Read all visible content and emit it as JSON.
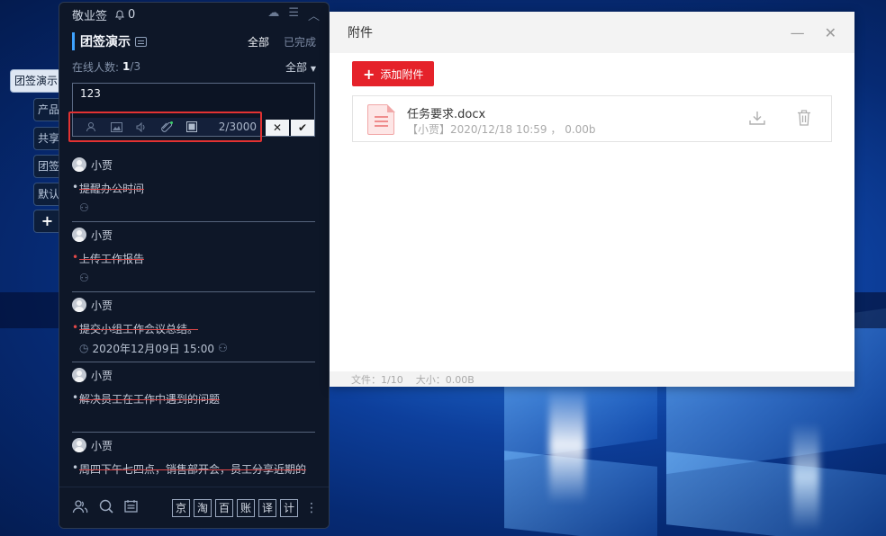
{
  "app": {
    "title": "敬业签",
    "notification_count": "0",
    "project_title": "团签演示",
    "filter_all": "全部",
    "filter_done": "已完成",
    "online_label": "在线人数:",
    "online_current": "1",
    "online_total": "/3",
    "member_filter": "全部",
    "editor_text": "123",
    "counter": "2/3000",
    "cancel_label": "✕",
    "confirm_label": "✔"
  },
  "side_tabs": [
    "团签演示",
    "产品",
    "共享",
    "团签",
    "默认",
    "+"
  ],
  "tasks": [
    {
      "user": "小贾",
      "text": "提醒办公时间",
      "red_bullet": false,
      "time": ""
    },
    {
      "user": "小贾",
      "text": "上传工作报告",
      "red_bullet": true,
      "time": ""
    },
    {
      "user": "小贾",
      "text": "提交小组工作会议总结。",
      "red_bullet": true,
      "time": "2020年12月09日 15:00"
    },
    {
      "user": "小贾",
      "text": "解决员工在工作中遇到的问题",
      "red_bullet": false,
      "time": ""
    },
    {
      "user": "小贾",
      "text": "周四下午七四点，销售部开会，员工分享近期的",
      "red_bullet": false,
      "time": ""
    }
  ],
  "bottom_bar": {
    "chips": [
      "京",
      "淘",
      "百",
      "账",
      "译",
      "计"
    ]
  },
  "dialog": {
    "title": "附件",
    "add_button": "添加附件",
    "file": {
      "name": "任务要求.docx",
      "meta": "【小贾】2020/12/18 10:59 ， 0.00b"
    },
    "footer_files": "文件：1/10",
    "footer_size": "大小：0.00B"
  }
}
